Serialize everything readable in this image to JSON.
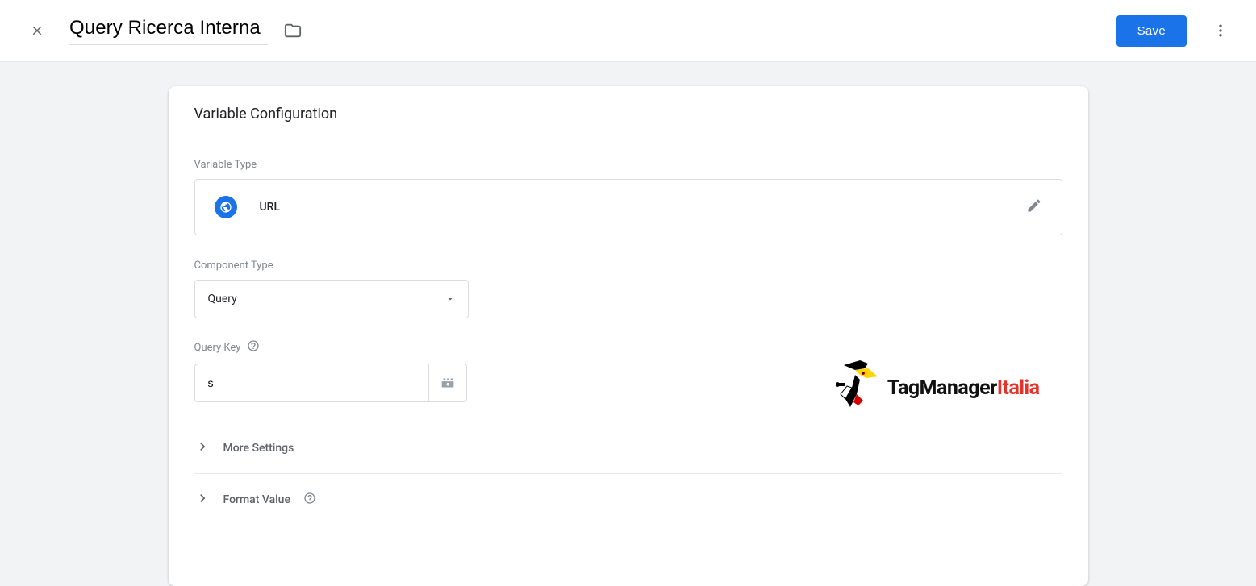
{
  "header": {
    "title": "Query Ricerca Interna",
    "save_label": "Save"
  },
  "card": {
    "title": "Variable Configuration",
    "variable_type_label": "Variable Type",
    "variable_type_value": "URL",
    "component_type_label": "Component Type",
    "component_type_value": "Query",
    "query_key_label": "Query Key",
    "query_key_value": "s",
    "more_settings_label": "More Settings",
    "format_value_label": "Format Value"
  },
  "logo": {
    "part1": "TagManager",
    "part2": "Italia"
  }
}
